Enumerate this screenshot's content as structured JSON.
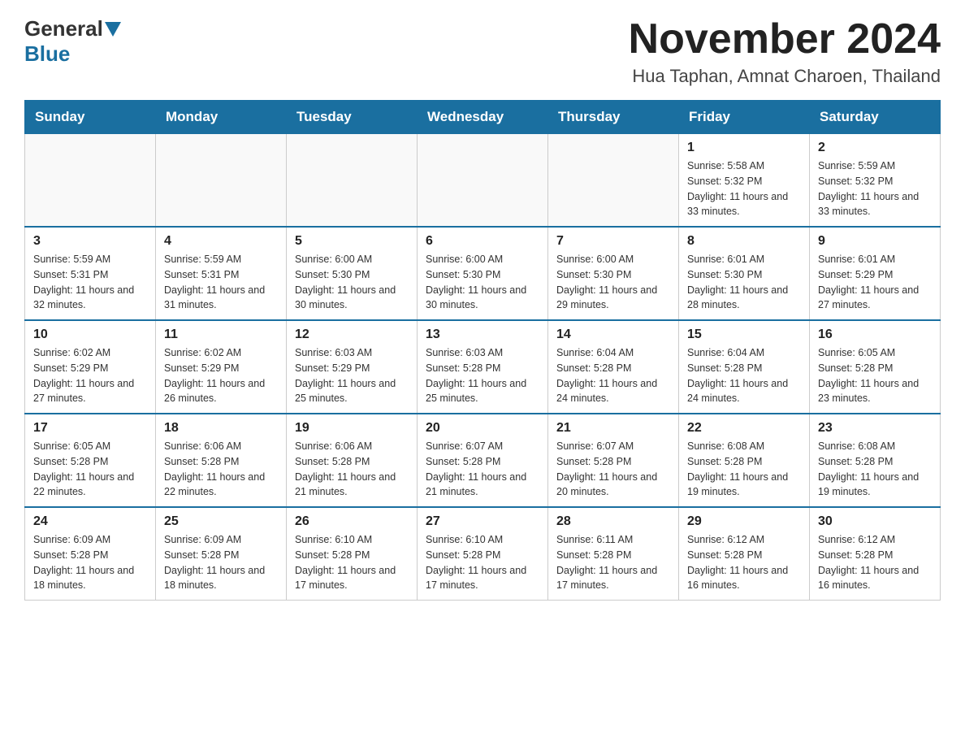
{
  "header": {
    "logo_general": "General",
    "logo_blue": "Blue",
    "month_title": "November 2024",
    "location": "Hua Taphan, Amnat Charoen, Thailand"
  },
  "days_of_week": [
    "Sunday",
    "Monday",
    "Tuesday",
    "Wednesday",
    "Thursday",
    "Friday",
    "Saturday"
  ],
  "weeks": [
    [
      {
        "day": "",
        "info": ""
      },
      {
        "day": "",
        "info": ""
      },
      {
        "day": "",
        "info": ""
      },
      {
        "day": "",
        "info": ""
      },
      {
        "day": "",
        "info": ""
      },
      {
        "day": "1",
        "info": "Sunrise: 5:58 AM\nSunset: 5:32 PM\nDaylight: 11 hours and 33 minutes."
      },
      {
        "day": "2",
        "info": "Sunrise: 5:59 AM\nSunset: 5:32 PM\nDaylight: 11 hours and 33 minutes."
      }
    ],
    [
      {
        "day": "3",
        "info": "Sunrise: 5:59 AM\nSunset: 5:31 PM\nDaylight: 11 hours and 32 minutes."
      },
      {
        "day": "4",
        "info": "Sunrise: 5:59 AM\nSunset: 5:31 PM\nDaylight: 11 hours and 31 minutes."
      },
      {
        "day": "5",
        "info": "Sunrise: 6:00 AM\nSunset: 5:30 PM\nDaylight: 11 hours and 30 minutes."
      },
      {
        "day": "6",
        "info": "Sunrise: 6:00 AM\nSunset: 5:30 PM\nDaylight: 11 hours and 30 minutes."
      },
      {
        "day": "7",
        "info": "Sunrise: 6:00 AM\nSunset: 5:30 PM\nDaylight: 11 hours and 29 minutes."
      },
      {
        "day": "8",
        "info": "Sunrise: 6:01 AM\nSunset: 5:30 PM\nDaylight: 11 hours and 28 minutes."
      },
      {
        "day": "9",
        "info": "Sunrise: 6:01 AM\nSunset: 5:29 PM\nDaylight: 11 hours and 27 minutes."
      }
    ],
    [
      {
        "day": "10",
        "info": "Sunrise: 6:02 AM\nSunset: 5:29 PM\nDaylight: 11 hours and 27 minutes."
      },
      {
        "day": "11",
        "info": "Sunrise: 6:02 AM\nSunset: 5:29 PM\nDaylight: 11 hours and 26 minutes."
      },
      {
        "day": "12",
        "info": "Sunrise: 6:03 AM\nSunset: 5:29 PM\nDaylight: 11 hours and 25 minutes."
      },
      {
        "day": "13",
        "info": "Sunrise: 6:03 AM\nSunset: 5:28 PM\nDaylight: 11 hours and 25 minutes."
      },
      {
        "day": "14",
        "info": "Sunrise: 6:04 AM\nSunset: 5:28 PM\nDaylight: 11 hours and 24 minutes."
      },
      {
        "day": "15",
        "info": "Sunrise: 6:04 AM\nSunset: 5:28 PM\nDaylight: 11 hours and 24 minutes."
      },
      {
        "day": "16",
        "info": "Sunrise: 6:05 AM\nSunset: 5:28 PM\nDaylight: 11 hours and 23 minutes."
      }
    ],
    [
      {
        "day": "17",
        "info": "Sunrise: 6:05 AM\nSunset: 5:28 PM\nDaylight: 11 hours and 22 minutes."
      },
      {
        "day": "18",
        "info": "Sunrise: 6:06 AM\nSunset: 5:28 PM\nDaylight: 11 hours and 22 minutes."
      },
      {
        "day": "19",
        "info": "Sunrise: 6:06 AM\nSunset: 5:28 PM\nDaylight: 11 hours and 21 minutes."
      },
      {
        "day": "20",
        "info": "Sunrise: 6:07 AM\nSunset: 5:28 PM\nDaylight: 11 hours and 21 minutes."
      },
      {
        "day": "21",
        "info": "Sunrise: 6:07 AM\nSunset: 5:28 PM\nDaylight: 11 hours and 20 minutes."
      },
      {
        "day": "22",
        "info": "Sunrise: 6:08 AM\nSunset: 5:28 PM\nDaylight: 11 hours and 19 minutes."
      },
      {
        "day": "23",
        "info": "Sunrise: 6:08 AM\nSunset: 5:28 PM\nDaylight: 11 hours and 19 minutes."
      }
    ],
    [
      {
        "day": "24",
        "info": "Sunrise: 6:09 AM\nSunset: 5:28 PM\nDaylight: 11 hours and 18 minutes."
      },
      {
        "day": "25",
        "info": "Sunrise: 6:09 AM\nSunset: 5:28 PM\nDaylight: 11 hours and 18 minutes."
      },
      {
        "day": "26",
        "info": "Sunrise: 6:10 AM\nSunset: 5:28 PM\nDaylight: 11 hours and 17 minutes."
      },
      {
        "day": "27",
        "info": "Sunrise: 6:10 AM\nSunset: 5:28 PM\nDaylight: 11 hours and 17 minutes."
      },
      {
        "day": "28",
        "info": "Sunrise: 6:11 AM\nSunset: 5:28 PM\nDaylight: 11 hours and 17 minutes."
      },
      {
        "day": "29",
        "info": "Sunrise: 6:12 AM\nSunset: 5:28 PM\nDaylight: 11 hours and 16 minutes."
      },
      {
        "day": "30",
        "info": "Sunrise: 6:12 AM\nSunset: 5:28 PM\nDaylight: 11 hours and 16 minutes."
      }
    ]
  ]
}
